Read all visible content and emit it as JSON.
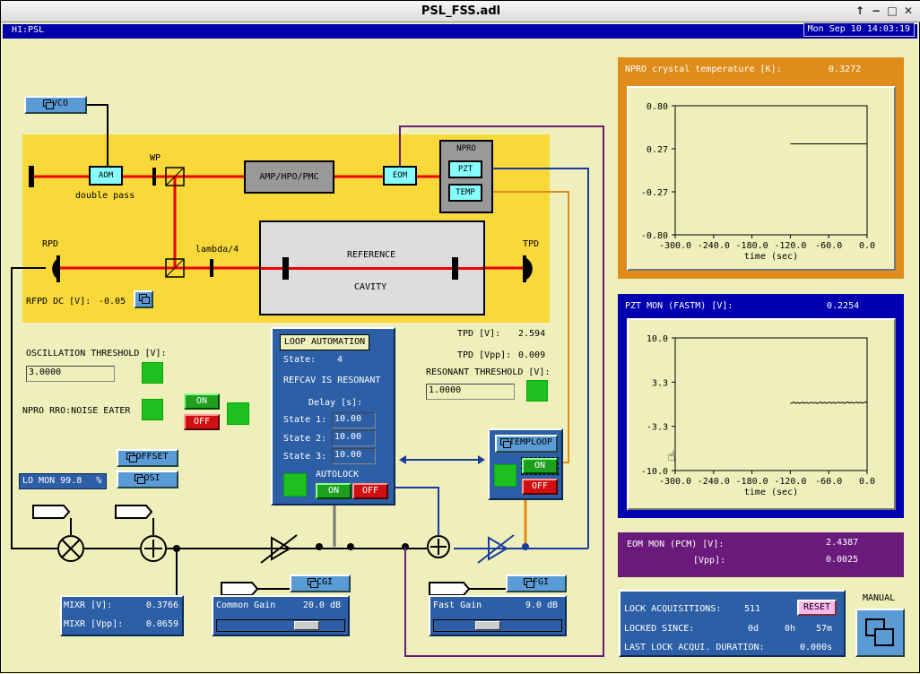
{
  "window": {
    "title": "PSL_FSS.adl",
    "controls": [
      "↑",
      "−",
      "□",
      "✕"
    ]
  },
  "header": {
    "channel": "H1:PSL",
    "datetime": "Mon Sep 10 14:03:19"
  },
  "buttons": {
    "vco": "VCO",
    "offset": "OFFSET",
    "osi": "OSI",
    "cgi": "CGI",
    "fgi": "FGI",
    "temploop": "TEMPLOOP",
    "reset": "RESET",
    "manual": "MANUAL"
  },
  "optics": {
    "aom": "AOM",
    "double_pass": "double pass",
    "wp": "WP",
    "amp": "AMP/HPO/PMC",
    "eom": "EOM",
    "npro": "NPRO",
    "pzt": "PZT",
    "temp": "TEMP",
    "rpd": "RPD",
    "tpd": "TPD",
    "lambda4": "lambda/4",
    "reference": "REFERENCE",
    "cavity": "CAVITY"
  },
  "rfpd": {
    "label": "RFPD DC [V]:",
    "value": "-0.05"
  },
  "oscillation": {
    "label": "OSCILLATION THRESHOLD [V]:",
    "value": "3.0000"
  },
  "noise_eater": {
    "label": "NPRO RRO:NOISE EATER",
    "on": "ON",
    "off": "OFF"
  },
  "lo_mon": {
    "label": "LO MON",
    "value": "99.8",
    "unit": "%"
  },
  "mixr": {
    "v_label": "MIXR [V]:",
    "v_value": "0.3766",
    "vpp_label": "MIXR [Vpp]:",
    "vpp_value": "0.0659"
  },
  "common_gain": {
    "label": "Common Gain",
    "value": "20.0 dB",
    "level": 0.75
  },
  "fast_gain": {
    "label": "Fast Gain",
    "value": "9.0 dB",
    "level": 0.4
  },
  "loop": {
    "title": "LOOP AUTOMATION",
    "state_label": "State:",
    "state_value": "4",
    "status": "REFCAV IS RESONANT",
    "delay_label": "Delay [s]:",
    "state1_label": "State 1:",
    "state1": "10.00",
    "state2_label": "State 2:",
    "state2": "10.00",
    "state3_label": "State 3:",
    "state3": "10.00",
    "autolock": "AUTOLOCK",
    "on": "ON",
    "off": "OFF"
  },
  "tpd": {
    "v_label": "TPD [V]:",
    "v_value": "2.594",
    "vpp_label": "TPD [Vpp]:",
    "vpp_value": "0.009",
    "res_label": "RESONANT THRESHOLD [V]:",
    "res_value": "1.0000"
  },
  "temploop": {
    "on": "ON",
    "off": "OFF"
  },
  "npro_temp": {
    "title": "NPRO crystal temperature [K]:",
    "value": "0.3272",
    "accent": "#e08c1a",
    "yticks": [
      "0.80",
      "0.27",
      "-0.27",
      "-0.80"
    ],
    "xticks": [
      "-300.0",
      "-240.0",
      "-180.0",
      "-120.0",
      "-60.0",
      "0.0"
    ],
    "xlabel": "time (sec)"
  },
  "pzt_mon": {
    "title": "PZT MON (FASTM) [V]:",
    "value": "0.2254",
    "accent": "#0000b0",
    "yticks": [
      "10.0",
      "3.3",
      "-3.3",
      "-10.0"
    ],
    "xticks": [
      "-300.0",
      "-240.0",
      "-180.0",
      "-120.0",
      "-60.0",
      "0.0"
    ],
    "xlabel": "time (sec)"
  },
  "eom_mon": {
    "label": "EOM MON (PCM) [V]:",
    "value": "2.4387",
    "vpp_label": "[Vpp]:",
    "vpp_value": "0.0025",
    "accent": "#6a1a7a"
  },
  "lock": {
    "acq_label": "LOCK ACQUISITIONS:",
    "acq_value": "511",
    "since_label": "LOCKED SINCE:",
    "since_d": "0d",
    "since_h": "0h",
    "since_m": "57m",
    "last_label": "LAST LOCK ACQUI. DURATION:",
    "last_value": "0.000s"
  },
  "chart_data": [
    {
      "type": "line",
      "title": "NPRO crystal temperature [K]:",
      "xlabel": "time (sec)",
      "ylabel": "",
      "xlim": [
        -300,
        0
      ],
      "ylim": [
        -0.8,
        0.8
      ],
      "series": [
        {
          "x": [
            -120,
            0
          ],
          "y": [
            0.3272,
            0.3272
          ]
        }
      ]
    },
    {
      "type": "line",
      "title": "PZT MON (FASTM) [V]:",
      "xlabel": "time (sec)",
      "ylabel": "",
      "xlim": [
        -300,
        0
      ],
      "ylim": [
        -10,
        10
      ],
      "series": [
        {
          "x": [
            -120,
            0
          ],
          "y": [
            0.2,
            0.25
          ]
        }
      ]
    }
  ]
}
